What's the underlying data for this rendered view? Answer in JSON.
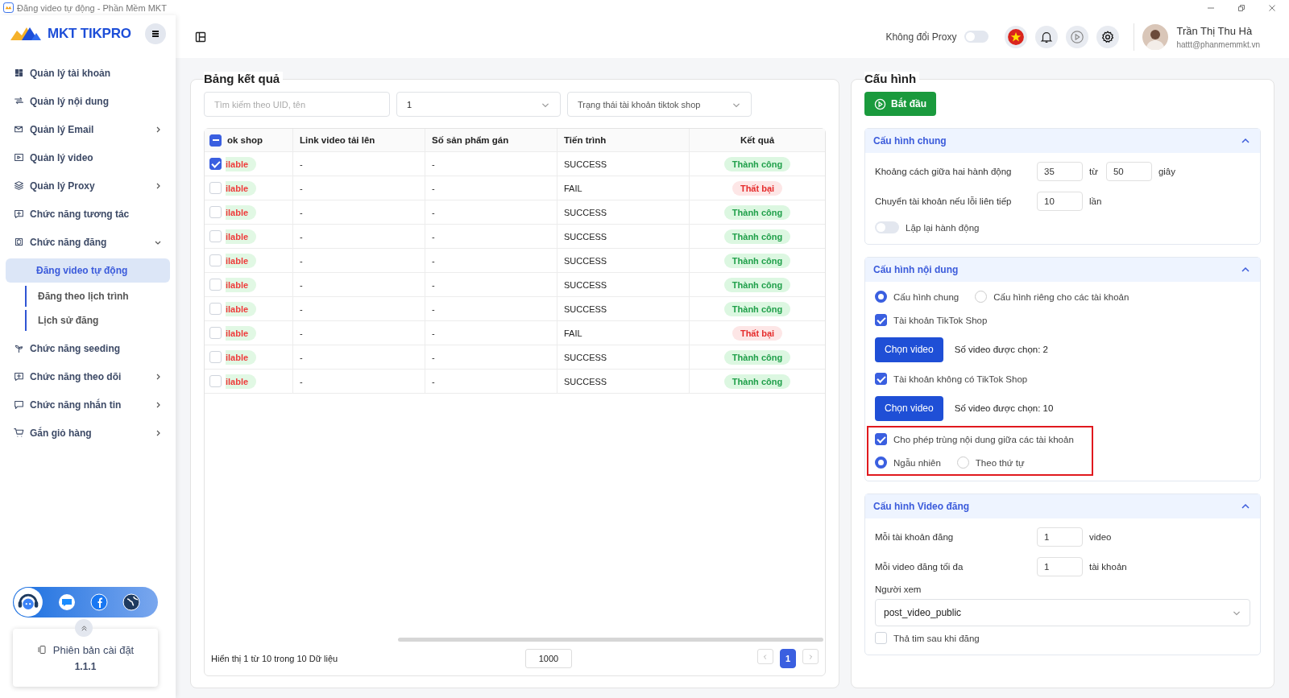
{
  "window": {
    "title": "Đăng video tự động - Phần Mềm MKT"
  },
  "sidebar": {
    "logo": "MKT TIKPRO",
    "items": [
      {
        "label": "Quản lý tài khoản",
        "has_submenu": false
      },
      {
        "label": "Quản lý nội dung",
        "has_submenu": false
      },
      {
        "label": "Quản lý Email",
        "has_submenu": true,
        "expanded": false
      },
      {
        "label": "Quản lý video",
        "has_submenu": false
      },
      {
        "label": "Quản lý Proxy",
        "has_submenu": true,
        "expanded": false
      },
      {
        "label": "Chức năng tương tác",
        "has_submenu": false
      },
      {
        "label": "Chức năng đăng",
        "has_submenu": true,
        "expanded": true,
        "children": [
          {
            "label": "Đăng video tự động",
            "selected": true
          },
          {
            "label": "Đăng theo lịch trình",
            "selected": false
          },
          {
            "label": "Lịch sử đăng",
            "selected": false
          }
        ]
      },
      {
        "label": "Chức năng seeding",
        "has_submenu": false
      },
      {
        "label": "Chức năng theo dõi",
        "has_submenu": true,
        "expanded": false
      },
      {
        "label": "Chức năng nhắn tin",
        "has_submenu": true,
        "expanded": false
      },
      {
        "label": "Gắn giỏ hàng",
        "has_submenu": true,
        "expanded": false
      }
    ],
    "version": {
      "label": "Phiên bản cài đặt",
      "value": "1.1.1"
    }
  },
  "header": {
    "proxy_toggle": {
      "label": "Không đổi Proxy",
      "on": false
    },
    "user": {
      "name": "Trần Thị Thu Hà",
      "email": "hattt@phanmemmkt.vn"
    }
  },
  "results": {
    "title": "Bảng kết quả",
    "search": {
      "placeholder": "Tìm kiếm theo UID, tên"
    },
    "count_select": {
      "value": "1"
    },
    "status_select": {
      "placeholder": "Trạng thái tài khoản tiktok shop"
    },
    "header_checkbox": {
      "indeterminate": true
    },
    "columns": [
      "ok shop",
      "Link video tải lên",
      "Số sản phẩm gán",
      "Tiến trình",
      "Kết quả"
    ],
    "rows": [
      {
        "checked": true,
        "shop": "ilable",
        "link": "-",
        "products": "-",
        "progress": "SUCCESS",
        "result": "Thành công",
        "kind": "success"
      },
      {
        "checked": false,
        "shop": "ilable",
        "link": "-",
        "products": "-",
        "progress": "FAIL",
        "result": "Thất bại",
        "kind": "fail"
      },
      {
        "checked": false,
        "shop": "ilable",
        "link": "-",
        "products": "-",
        "progress": "SUCCESS",
        "result": "Thành công",
        "kind": "success"
      },
      {
        "checked": false,
        "shop": "ilable",
        "link": "-",
        "products": "-",
        "progress": "SUCCESS",
        "result": "Thành công",
        "kind": "success"
      },
      {
        "checked": false,
        "shop": "ilable",
        "link": "-",
        "products": "-",
        "progress": "SUCCESS",
        "result": "Thành công",
        "kind": "success"
      },
      {
        "checked": false,
        "shop": "ilable",
        "link": "-",
        "products": "-",
        "progress": "SUCCESS",
        "result": "Thành công",
        "kind": "success"
      },
      {
        "checked": false,
        "shop": "ilable",
        "link": "-",
        "products": "-",
        "progress": "SUCCESS",
        "result": "Thành công",
        "kind": "success"
      },
      {
        "checked": false,
        "shop": "ilable",
        "link": "-",
        "products": "-",
        "progress": "FAIL",
        "result": "Thất bại",
        "kind": "fail"
      },
      {
        "checked": false,
        "shop": "ilable",
        "link": "-",
        "products": "-",
        "progress": "SUCCESS",
        "result": "Thành công",
        "kind": "success"
      },
      {
        "checked": false,
        "shop": "ilable",
        "link": "-",
        "products": "-",
        "progress": "SUCCESS",
        "result": "Thành công",
        "kind": "success"
      }
    ],
    "footer": {
      "summary": "Hiển thị 1 từ 10 trong 10 Dữ liệu",
      "page_size": "1000",
      "pages": [
        {
          "label": "1",
          "selected": true
        }
      ]
    }
  },
  "config": {
    "title": "Cấu hình",
    "start_button": "Bắt đầu",
    "sections": [
      {
        "title": "Cấu hình chung",
        "expanded": true,
        "rows": [
          {
            "kind": "range",
            "label": "Khoảng cách giữa hai hành động",
            "from": "35",
            "sep": "từ",
            "to": "50",
            "unit": "giây",
            "highlighted": false
          },
          {
            "kind": "number",
            "label": "Chuyển tài khoản nếu lỗi liên tiếp",
            "value": "10",
            "unit": "lần",
            "highlighted": false
          },
          {
            "kind": "toggle",
            "label": "Lặp lại hành động",
            "on": false,
            "highlighted": false
          }
        ]
      },
      {
        "title": "Cấu hình nội dung",
        "expanded": true,
        "rows": [
          {
            "kind": "radios",
            "options": [
              {
                "label": "Cấu hình chung",
                "selected": true
              },
              {
                "label": "Cấu hình riêng cho các tài khoản",
                "selected": false
              }
            ],
            "highlighted": false
          },
          {
            "kind": "checkbox",
            "label": "Tài khoản TikTok Shop",
            "checked": true,
            "highlighted": false
          },
          {
            "kind": "picker",
            "button": "Chọn video",
            "text": "Số video được chọn: 2",
            "highlighted": false
          },
          {
            "kind": "checkbox",
            "label": "Tài khoản không có TikTok Shop",
            "checked": true,
            "highlighted": false
          },
          {
            "kind": "picker",
            "button": "Chọn video",
            "text": "Số video được chọn: 10",
            "highlighted": false
          },
          {
            "kind": "checkbox",
            "label": "Cho phép trùng nội dung giữa các tài khoản",
            "checked": true,
            "highlighted": true
          },
          {
            "kind": "radios",
            "options": [
              {
                "label": "Ngẫu nhiên",
                "selected": true
              },
              {
                "label": "Theo thứ tự",
                "selected": false
              }
            ],
            "highlighted": true
          }
        ]
      },
      {
        "title": "Cấu hình Video đăng",
        "expanded": true,
        "rows": [
          {
            "kind": "number",
            "label": "Mỗi tài khoản đăng",
            "value": "1",
            "unit": "video",
            "highlighted": false
          },
          {
            "kind": "number",
            "label": "Mỗi video đăng tối đa",
            "value": "1",
            "unit": "tài khoản",
            "highlighted": false
          },
          {
            "kind": "select",
            "label": "Người xem",
            "value": "post_video_public",
            "highlighted": false
          },
          {
            "kind": "checkbox",
            "label": "Thả tim sau khi đăng",
            "checked": false,
            "highlighted": false
          }
        ]
      }
    ]
  }
}
